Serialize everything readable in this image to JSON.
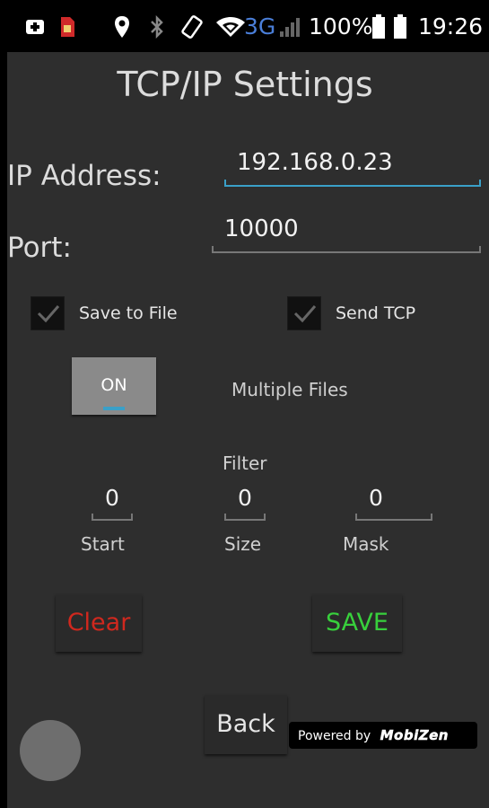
{
  "status_bar": {
    "network_label": "3G",
    "battery_percent": "100%",
    "time": "19:26",
    "icons": [
      "notification-plus-icon",
      "sim-card-icon",
      "location-pin-icon",
      "bluetooth-icon",
      "screen-rotate-icon",
      "wifi-icon",
      "signal-icon",
      "battery-icon",
      "battery-full-icon"
    ]
  },
  "screen": {
    "title": "TCP/IP Settings",
    "ip_address": {
      "label": "IP Address:",
      "value": "192.168.0.23"
    },
    "port": {
      "label": "Port:",
      "value": "10000"
    },
    "save_to_file": {
      "label": "Save to File",
      "checked": true
    },
    "send_tcp": {
      "label": "Send TCP",
      "checked": true
    },
    "multiple_files": {
      "toggle_label": "ON",
      "label": "Multiple Files"
    },
    "filter": {
      "heading": "Filter",
      "start": {
        "label": "Start",
        "value": "0"
      },
      "size": {
        "label": "Size",
        "value": "0"
      },
      "mask": {
        "label": "Mask",
        "value": "0"
      }
    },
    "buttons": {
      "clear": "Clear",
      "save": "SAVE",
      "back": "Back"
    }
  },
  "watermark": {
    "prefix": "Powered by",
    "brand": "MobiZen"
  },
  "colors": {
    "background": "#2e2e2e",
    "accent": "#3aa0c8",
    "clear_text": "#d0281e",
    "save_text": "#38d03c"
  }
}
